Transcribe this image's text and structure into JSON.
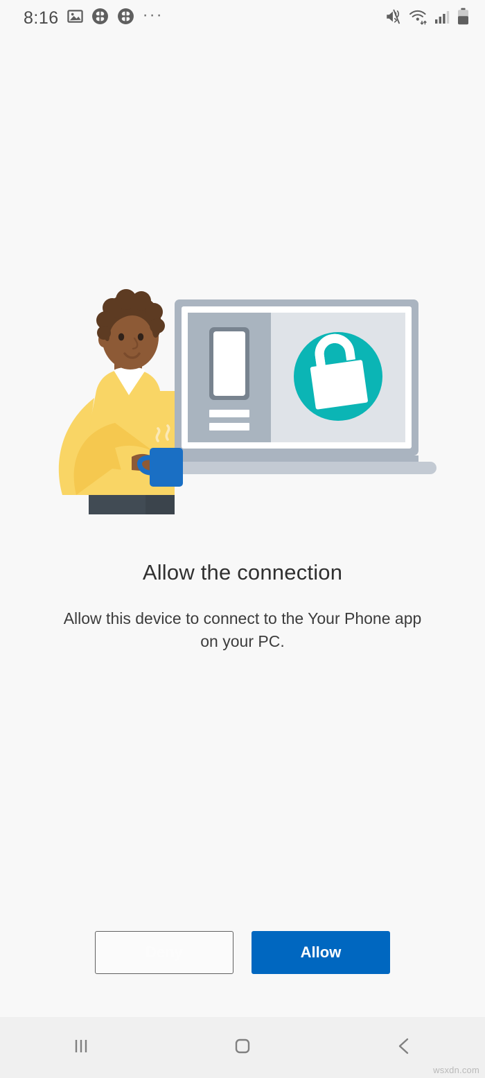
{
  "statusbar": {
    "time": "8:16",
    "left_icons": [
      {
        "name": "photo-gallery-icon",
        "label": "gallery"
      },
      {
        "name": "app-badge-icon-1",
        "label": "app"
      },
      {
        "name": "app-badge-icon-2",
        "label": "app"
      }
    ],
    "overflow": "···",
    "right_icons": [
      {
        "name": "mute-vibrate-icon",
        "label": "sound off"
      },
      {
        "name": "wifi-icon",
        "label": "wifi"
      },
      {
        "name": "signal-bars-icon",
        "label": "signal"
      },
      {
        "name": "battery-icon",
        "label": "battery"
      }
    ]
  },
  "illustration": {
    "alt": "person holding mug next to a laptop showing an unlocked padlock",
    "colors": {
      "skin": "#8d5a36",
      "hair": "#5d3b22",
      "sweater": "#f9d565",
      "sweater_shade": "#f5c84f",
      "collar": "#ffffff",
      "pants": "#414b54",
      "mug": "#1a6fc4",
      "laptop_frame": "#aab4c0",
      "laptop_screen": "#dfe3e8",
      "laptop_sidebar": "#a9b4bf",
      "laptop_base": "#c3cad3",
      "lock_circle": "#0bb5b5",
      "lock_body": "#ffffff",
      "phone_frame": "#78838f"
    }
  },
  "main": {
    "title": "Allow the connection",
    "subtitle": "Allow this device to connect to the Your Phone app on your PC."
  },
  "buttons": {
    "deny_label": "Deny",
    "allow_label": "Allow",
    "deny_color": "#fcfcfc",
    "allow_color": "#0067c0"
  },
  "navbar": {
    "recents_label": "Recents",
    "home_label": "Home",
    "back_label": "Back"
  },
  "watermark": "wsxdn.com"
}
